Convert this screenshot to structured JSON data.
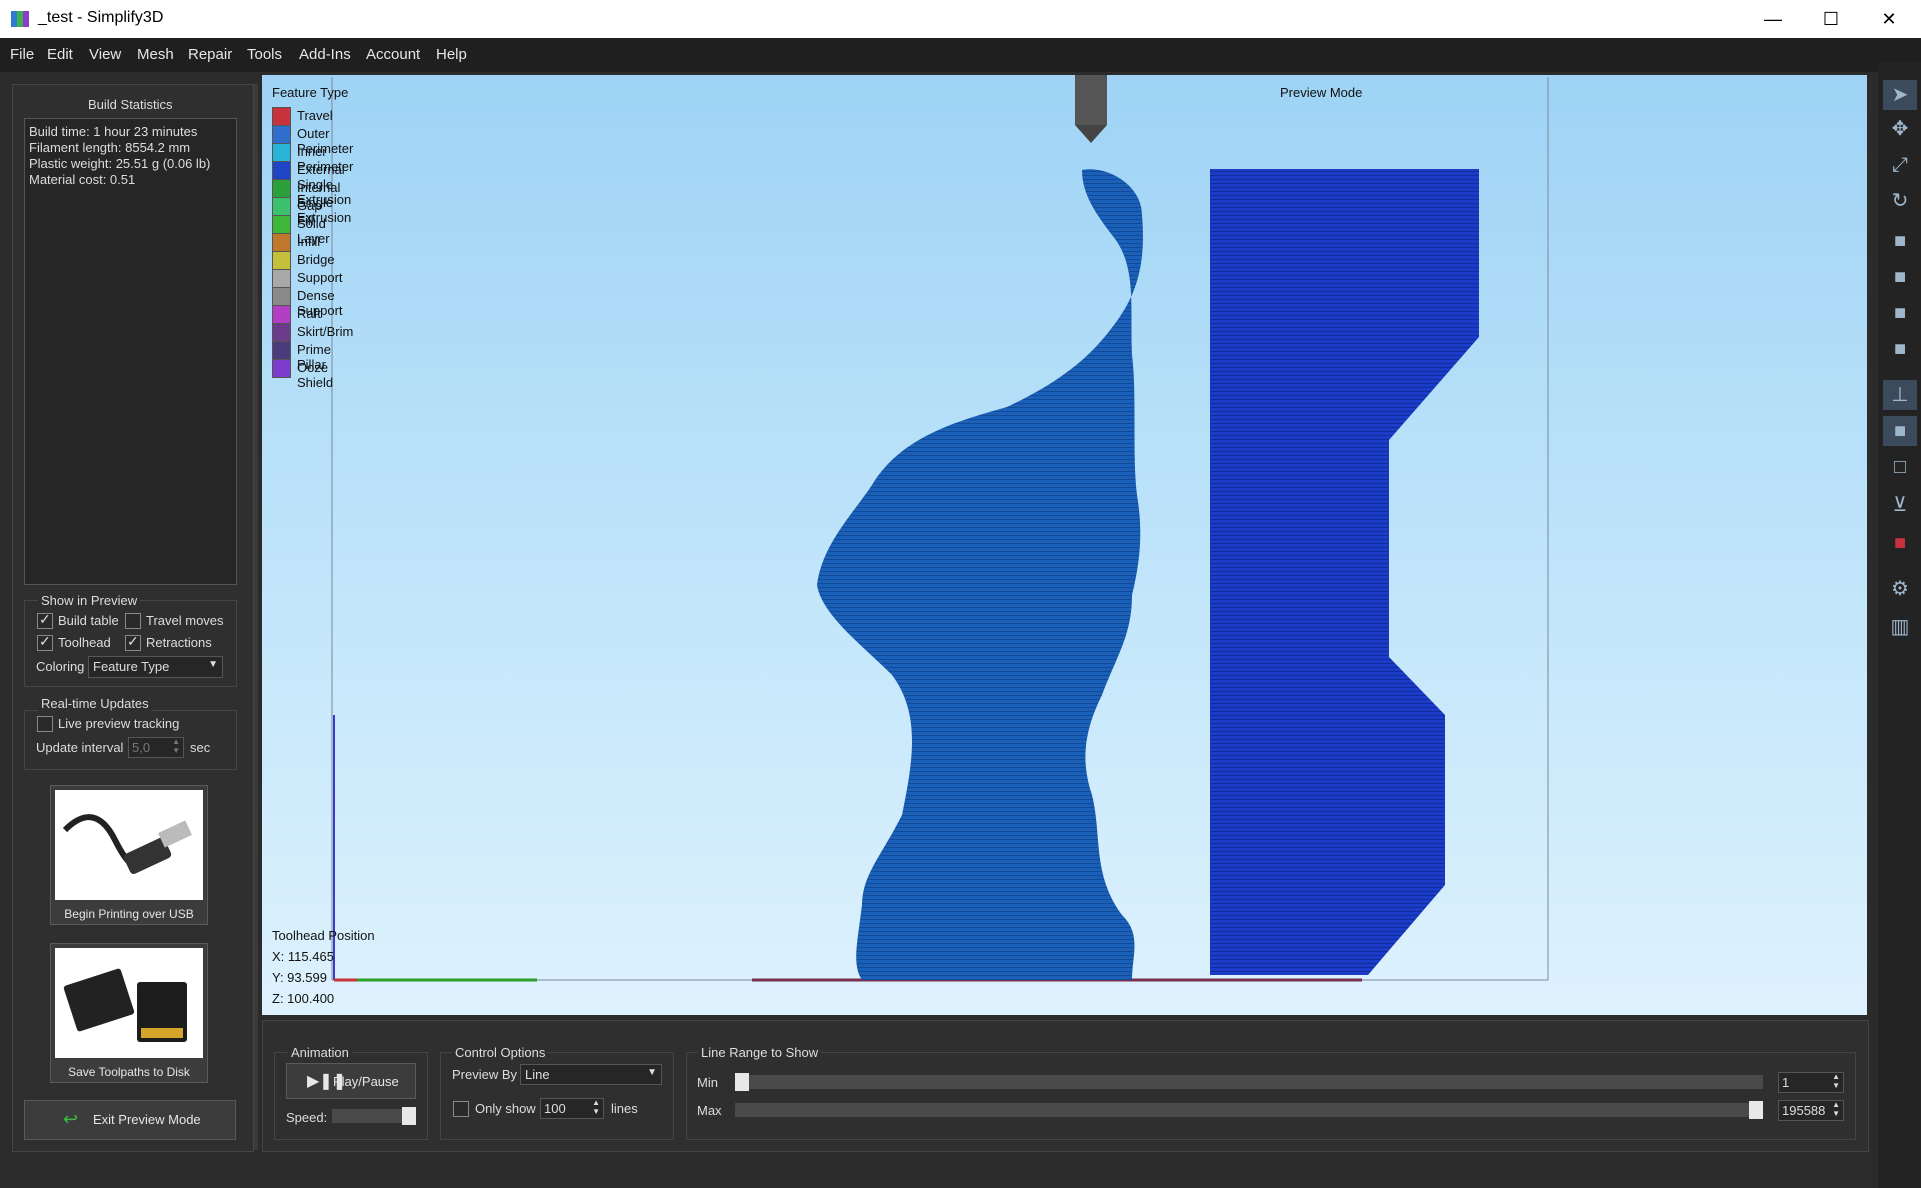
{
  "window": {
    "title": "_test - Simplify3D",
    "minimize": "—",
    "maximize": "☐",
    "close": "✕"
  },
  "menu": [
    "File",
    "Edit",
    "View",
    "Mesh",
    "Repair",
    "Tools",
    "Add-Ins",
    "Account",
    "Help"
  ],
  "build_statistics": {
    "title": "Build Statistics",
    "lines": [
      "Build time: 1 hour 23 minutes",
      "Filament length: 8554.2 mm",
      "Plastic weight: 25.51 g (0.06 lb)",
      "Material cost: 0.51"
    ]
  },
  "show_in_preview": {
    "title": "Show in Preview",
    "build_table": "Build table",
    "build_table_checked": true,
    "travel_moves": "Travel moves",
    "travel_moves_checked": false,
    "toolhead": "Toolhead",
    "toolhead_checked": true,
    "retractions": "Retractions",
    "retractions_checked": true,
    "coloring_label": "Coloring",
    "coloring_value": "Feature Type"
  },
  "realtime": {
    "title": "Real-time Updates",
    "live_tracking": "Live preview tracking",
    "live_tracking_checked": false,
    "interval_label": "Update interval",
    "interval_value": "5,0",
    "interval_unit": "sec"
  },
  "usb_button": "Begin Printing over USB",
  "sd_button": "Save Toolpaths to Disk",
  "exit_button": "Exit Preview Mode",
  "viewport": {
    "legend_title": "Feature Type",
    "preview_mode": "Preview Mode",
    "legend": [
      {
        "label": "Travel",
        "color": "#c8323c"
      },
      {
        "label": "Outer Perimeter",
        "color": "#2f6fcc"
      },
      {
        "label": "Inner Perimeter",
        "color": "#27b4d6"
      },
      {
        "label": "External Single Extrusion",
        "color": "#1f44c4"
      },
      {
        "label": "Internal Single Extrusion",
        "color": "#2b9f3a"
      },
      {
        "label": "Gap Fill",
        "color": "#3cc06e"
      },
      {
        "label": "Solid Layer",
        "color": "#3db83a"
      },
      {
        "label": "Infill",
        "color": "#c0782c"
      },
      {
        "label": "Bridge",
        "color": "#c4c03a"
      },
      {
        "label": "Support",
        "color": "#a8a8a8"
      },
      {
        "label": "Dense Support",
        "color": "#8a8a8a"
      },
      {
        "label": "Raft",
        "color": "#b23ec4"
      },
      {
        "label": "Skirt/Brim",
        "color": "#6a3c8a"
      },
      {
        "label": "Prime Pillar",
        "color": "#4a3c7a"
      },
      {
        "label": "Ooze Shield",
        "color": "#7c3ccc"
      }
    ],
    "toolhead_title": "Toolhead Position",
    "x": "X: 115.465",
    "y": "Y: 93.599",
    "z": "Z: 100.400"
  },
  "animation": {
    "title": "Animation",
    "play": "Play/Pause",
    "speed_label": "Speed:"
  },
  "control": {
    "title": "Control Options",
    "preview_by_label": "Preview By",
    "preview_by_value": "Line",
    "only_show": "Only show",
    "only_show_checked": false,
    "lines_value": "100",
    "lines_unit": "lines"
  },
  "line_range": {
    "title": "Line Range to Show",
    "min_label": "Min",
    "min_value": "1",
    "max_label": "Max",
    "max_value": "195588",
    "min_fraction": 0.0,
    "max_fraction": 1.0
  }
}
